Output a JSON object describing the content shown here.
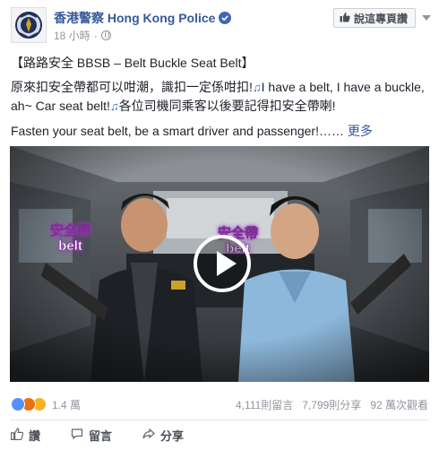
{
  "header": {
    "page_name": "香港警察 Hong Kong Police",
    "timestamp": "18 小時",
    "dot": "·",
    "like_page_label": "說這專頁讚"
  },
  "post": {
    "title_line": "【路路安全 BBSB – Belt Buckle Seat Belt】",
    "line1": "原來扣安全帶都可以咁潮，識扣一定係咁扣!",
    "line1_en": "I have a belt, I have a buckle, ah~ Car seat belt!",
    "line1_tail": "各位司機同乘客以後要記得扣安全帶喇!",
    "line2": "Fasten your seat belt, be a smart driver and passenger!……",
    "see_more": "更多",
    "note_glyph": "♫"
  },
  "video": {
    "caption_left": [
      "安全帶",
      "belt"
    ],
    "caption_right": [
      "安全帶",
      "belt"
    ]
  },
  "stats": {
    "reactions": "1.4 萬",
    "comments": "4,111則留言",
    "shares": "7,799則分享",
    "views": "92 萬次觀看"
  },
  "actions": {
    "like": "讚",
    "comment": "留言",
    "share": "分享"
  },
  "colors": {
    "link": "#365899",
    "brand": "#4267b2",
    "muted": "#90949c",
    "caption_glow": "#a03cc0"
  }
}
